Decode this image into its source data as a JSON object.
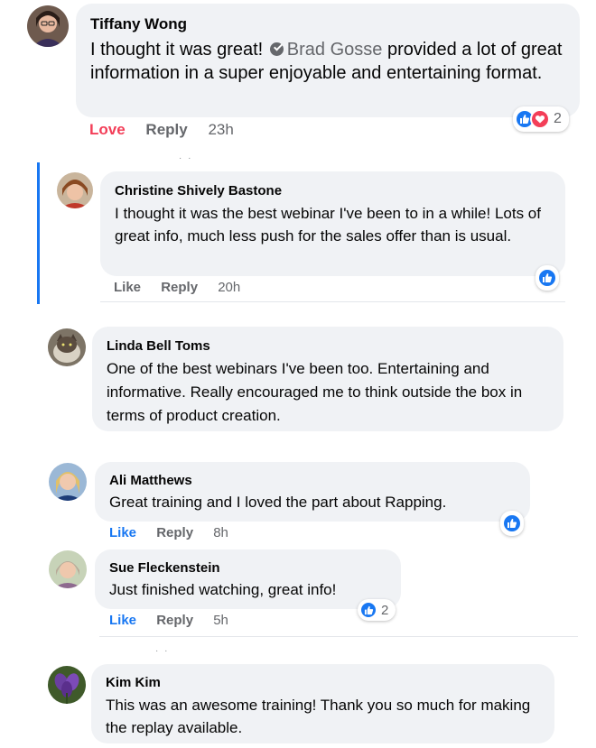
{
  "colors": {
    "bubble": "#f0f2f5",
    "link_blue": "#1877f2",
    "love_red": "#f33e58",
    "muted": "#65676b"
  },
  "icons": {
    "like": "like-reaction-icon",
    "love": "love-reaction-icon",
    "verified": "verified-badge-icon"
  },
  "comments": [
    {
      "author": "Tiffany Wong",
      "text_before": "I thought it was great!",
      "mention": "Brad Gosse",
      "text_after": "provided a lot of great information in a super enjoyable and entertaining format.",
      "reaction_label": "Love",
      "reply_label": "Reply",
      "time": "23h",
      "reaction_count": "2"
    },
    {
      "author": "Christine Shively Bastone",
      "text": "I thought it was the best webinar I've been to in a while! Lots of great info, much less push for the sales offer than is usual.",
      "like_label": "Like",
      "reply_label": "Reply",
      "time": "20h"
    },
    {
      "author": "Linda Bell Toms",
      "text": "One of the best webinars I've been too. Entertaining and informative. Really encouraged me to think outside the box in terms of product creation."
    },
    {
      "author": "Ali Matthews",
      "text": "Great training and I loved the part about Rapping.",
      "like_label": "Like",
      "reply_label": "Reply",
      "time": "8h"
    },
    {
      "author": "Sue Fleckenstein",
      "text": "Just finished watching, great info!",
      "like_label": "Like",
      "reply_label": "Reply",
      "time": "5h",
      "reaction_count": "2"
    },
    {
      "author": "Kim Kim",
      "text": "This was an awesome training! Thank you so much for making the replay available."
    }
  ]
}
